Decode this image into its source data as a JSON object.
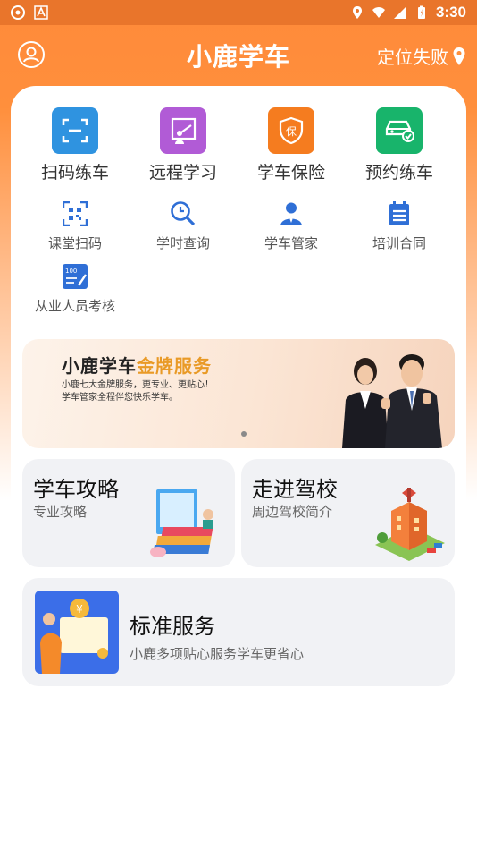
{
  "status": {
    "time": "3:30"
  },
  "header": {
    "title": "小鹿学车",
    "location": "定位失败"
  },
  "main_actions": [
    {
      "label": "扫码练车",
      "icon": "scan-icon",
      "color": "#2f93e0"
    },
    {
      "label": "远程学习",
      "icon": "remote-study-icon",
      "color": "#b15bd6"
    },
    {
      "label": "学车保险",
      "icon": "insurance-icon",
      "color": "#f57c1f"
    },
    {
      "label": "预约练车",
      "icon": "car-booking-icon",
      "color": "#18b46b"
    }
  ],
  "sub_actions": [
    {
      "label": "课堂扫码",
      "icon": "qr-scan-icon"
    },
    {
      "label": "学时查询",
      "icon": "time-search-icon"
    },
    {
      "label": "学车管家",
      "icon": "user-icon"
    },
    {
      "label": "培训合同",
      "icon": "contract-icon"
    },
    {
      "label": "从业人员考核",
      "icon": "assessment-icon"
    }
  ],
  "banner": {
    "title_a": "小鹿学车",
    "title_b": "金牌服务",
    "line1": "小鹿七大金牌服务，更专业、更贴心！",
    "line2": "学车管家全程伴您快乐学车。"
  },
  "tiles": [
    {
      "title": "学车攻略",
      "sub": "专业攻略"
    },
    {
      "title": "走进驾校",
      "sub": "周边驾校简介"
    }
  ],
  "standard": {
    "title": "标准服务",
    "sub": "小鹿多项贴心服务学车更省心"
  }
}
